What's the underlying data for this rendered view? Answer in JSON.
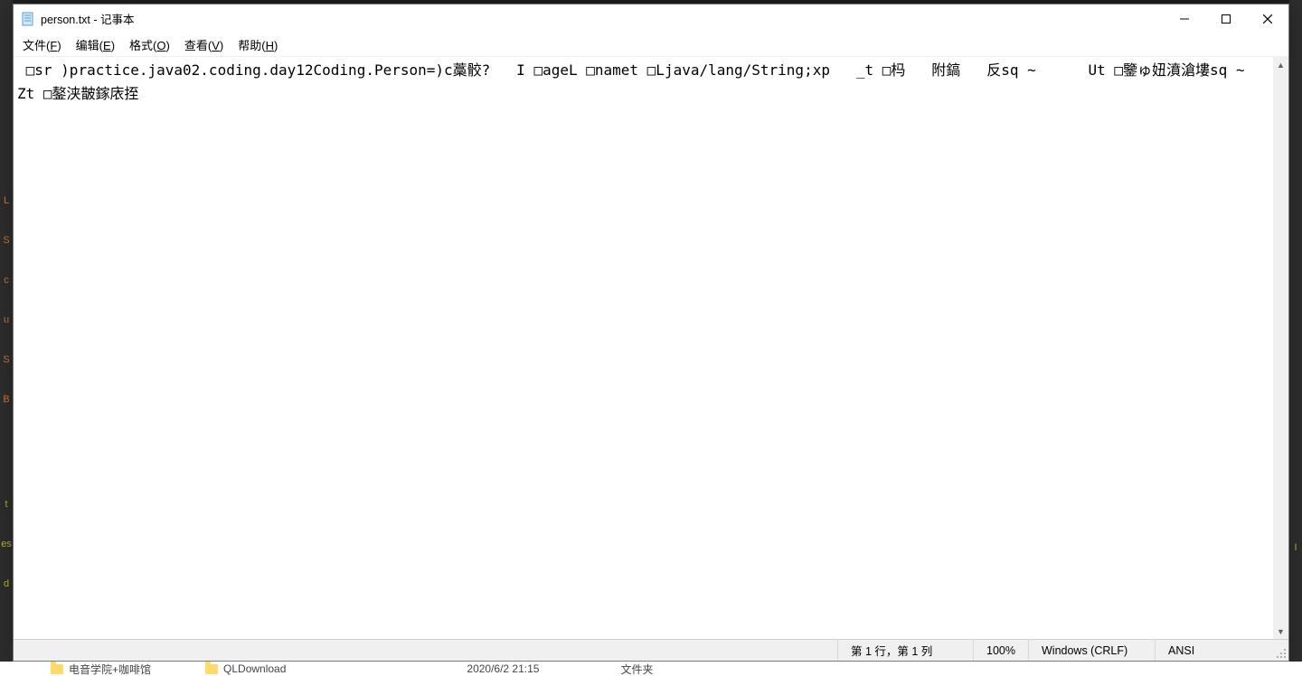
{
  "window": {
    "title": "person.txt - 记事本"
  },
  "menu": {
    "file": {
      "label": "文件",
      "accel": "F"
    },
    "edit": {
      "label": "编辑",
      "accel": "E"
    },
    "format": {
      "label": "格式",
      "accel": "O"
    },
    "view": {
      "label": "查看",
      "accel": "V"
    },
    "help": {
      "label": "帮助",
      "accel": "H"
    }
  },
  "content": {
    "text": " □sr )practice.java02.coding.day12Coding.Person=)c藁骹?   I □ageL □namet □Ljava/lang/String;xp   _t □杩   附鎬   反sq ~      Ut □鑒ゅ妞濆滄塿sq ~     Zt □鏊浃皵鎵庡挃"
  },
  "status": {
    "position": "第 1 行，第 1 列",
    "zoom": "100%",
    "eol": "Windows (CRLF)",
    "encoding": "ANSI"
  },
  "explorer_strip": {
    "item1": "电音学院+咖啡馆",
    "item2": "QLDownload",
    "date": "2020/6/2 21:15",
    "type": "文件夹"
  },
  "icons": {
    "notepad": "notepad-icon",
    "minimize": "minimize-icon",
    "maximize": "maximize-icon",
    "close": "close-icon",
    "scroll_up": "scroll-up-icon",
    "scroll_down": "scroll-down-icon",
    "grip": "resize-grip-icon",
    "folder": "folder-icon"
  }
}
